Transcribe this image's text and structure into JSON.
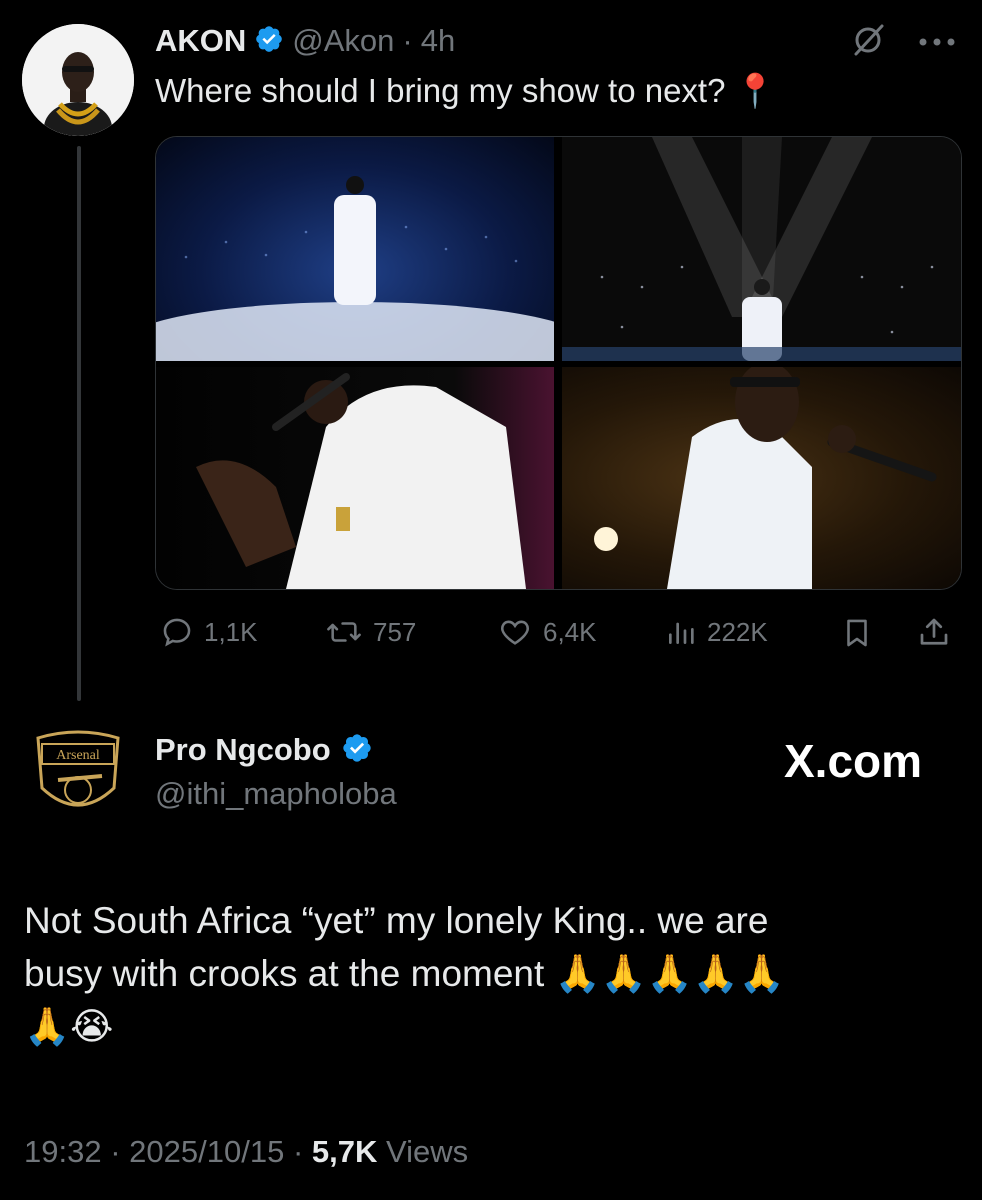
{
  "original_tweet": {
    "author_name": "AKON",
    "author_handle": "@Akon",
    "separator": "·",
    "time_ago": "4h",
    "text": "Where should I bring my show to next?",
    "pin_emoji": "📍",
    "stats": {
      "replies": "1,1K",
      "reposts": "757",
      "likes": "6,4K",
      "views": "222K"
    }
  },
  "reply_tweet": {
    "author_name": "Pro Ngcobo",
    "author_handle": "@ithi_mapholoba",
    "avatar_badge_text": "Arsenal",
    "watermark": "X.com",
    "text_line1": "Not South Africa “yet” my lonely King.. we are",
    "text_line2": "busy with crooks at the moment",
    "text_emojis_line2": "🙏🙏🙏🙏🙏",
    "text_emojis_line3": "🙏😭",
    "timestamp_time": "19:32",
    "timestamp_dot1": "·",
    "timestamp_date": "2025/10/15",
    "timestamp_dot2": "·",
    "view_count": "5,7K",
    "view_label": "Views"
  },
  "colors": {
    "background": "#000000",
    "text_primary": "#e7e9ea",
    "text_secondary": "#71767b",
    "verified_blue": "#1d9bf0",
    "thread_line": "#333639"
  },
  "icons": {
    "verified": "verified-badge-icon",
    "grok": "grok-slash-icon",
    "more": "more-dots-icon",
    "reply": "reply-bubble-icon",
    "repost": "repost-icon",
    "like": "heart-icon",
    "views": "analytics-bars-icon",
    "bookmark": "bookmark-icon",
    "share": "share-upload-icon"
  }
}
